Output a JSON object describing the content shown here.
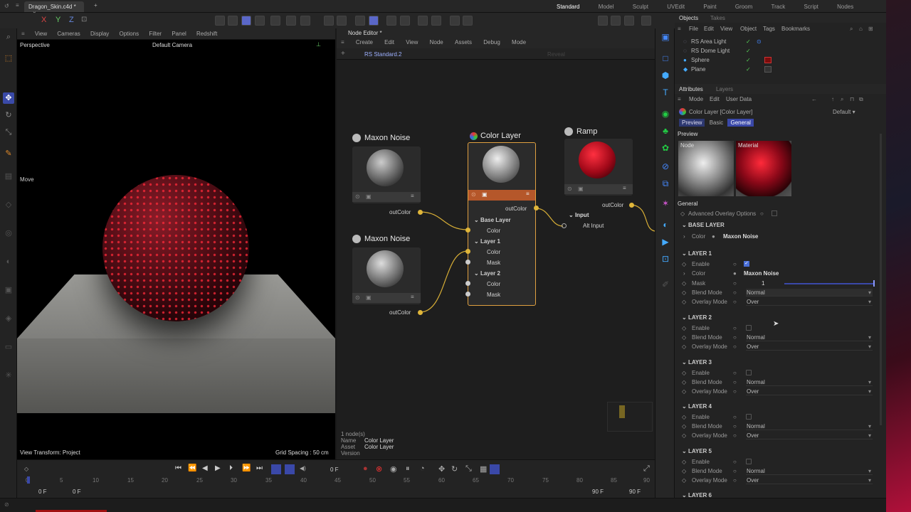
{
  "title_bar": {
    "tab_title": "Dragon_Skin.c4d *",
    "add_tab": "+"
  },
  "layouts": [
    "Standard",
    "Model",
    "Sculpt",
    "UVEdit",
    "Paint",
    "Groom",
    "Track",
    "Script",
    "Nodes"
  ],
  "active_layout": "Standard",
  "viewport": {
    "menu": [
      "View",
      "Cameras",
      "Display",
      "Options",
      "Filter",
      "Panel",
      "Redshift"
    ],
    "projection": "Perspective",
    "camera": "Default Camera",
    "tool_label": "Move",
    "view_transform": "View Transform: Project",
    "grid_spacing": "Grid Spacing : 50 cm"
  },
  "node_editor": {
    "title": "Node Editor *",
    "menu": [
      "Create",
      "Edit",
      "View",
      "Node",
      "Assets",
      "Debug",
      "Mode"
    ],
    "breadcrumb": "RS Standard.2",
    "reveal": "Reveal",
    "nodes": {
      "noise1": {
        "title": "Maxon Noise",
        "out": "outColor"
      },
      "noise2": {
        "title": "Maxon Noise",
        "out": "outColor"
      },
      "color_layer": {
        "title": "Color Layer",
        "out": "outColor",
        "base_layer": "Base Layer",
        "base_color": "Color",
        "layer1": "Layer 1",
        "layer1_color": "Color",
        "layer1_mask": "Mask",
        "layer2": "Layer 2",
        "layer2_color": "Color",
        "layer2_mask": "Mask"
      },
      "ramp": {
        "title": "Ramp",
        "out": "outColor",
        "input": "Input",
        "alt_input": "Alt Input"
      }
    },
    "info": {
      "count": "1 node(s)",
      "name_label": "Name",
      "name": "Color Layer",
      "asset_label": "Asset",
      "asset": "Color Layer",
      "version_label": "Version"
    }
  },
  "objects": {
    "tabs": [
      "Objects",
      "Takes"
    ],
    "menu": [
      "File",
      "Edit",
      "View",
      "Object",
      "Tags",
      "Bookmarks"
    ],
    "items": [
      "RS Area Light",
      "RS Dome Light",
      "Sphere",
      "Plane"
    ]
  },
  "attributes": {
    "tabs": [
      "Attributes",
      "Layers"
    ],
    "menu": [
      "Mode",
      "Edit",
      "User Data"
    ],
    "object_name": "Color Layer [Color Layer]",
    "preset": "Default",
    "subtabs": [
      "Preview",
      "Basic",
      "General"
    ],
    "preview_label": "Preview",
    "thumb_node": "Node",
    "thumb_material": "Material",
    "general_label": "General",
    "advanced_overlay": "Advanced Overlay Options",
    "base_layer": {
      "header": "BASE LAYER",
      "color_label": "Color",
      "color_value": "Maxon Noise"
    },
    "layer1": {
      "header": "LAYER 1",
      "enable": "Enable",
      "color_label": "Color",
      "color_value": "Maxon Noise",
      "mask_label": "Mask",
      "mask_value": "1",
      "blend_label": "Blend Mode",
      "blend_value": "Normal",
      "overlay_label": "Overlay Mode",
      "overlay_value": "Over"
    },
    "layer2": {
      "header": "LAYER 2",
      "enable": "Enable",
      "blend_label": "Blend Mode",
      "blend_value": "Normal",
      "overlay_label": "Overlay Mode",
      "overlay_value": "Over"
    },
    "layer3": {
      "header": "LAYER 3",
      "enable": "Enable",
      "blend_label": "Blend Mode",
      "blend_value": "Normal",
      "overlay_label": "Overlay Mode",
      "overlay_value": "Over"
    },
    "layer4": {
      "header": "LAYER 4",
      "enable": "Enable",
      "blend_label": "Blend Mode",
      "blend_value": "Normal",
      "overlay_label": "Overlay Mode",
      "overlay_value": "Over"
    },
    "layer5": {
      "header": "LAYER 5",
      "enable": "Enable",
      "blend_label": "Blend Mode",
      "blend_value": "Normal",
      "overlay_label": "Overlay Mode",
      "overlay_value": "Over"
    },
    "layer6": {
      "header": "LAYER 6"
    }
  },
  "timeline": {
    "current_frame": "0 F",
    "ticks": [
      "0",
      "5",
      "10",
      "15",
      "20",
      "25",
      "30",
      "35",
      "40",
      "45",
      "50",
      "55",
      "60",
      "65",
      "70",
      "75",
      "80",
      "85",
      "90"
    ],
    "start": "0 F",
    "start2": "0 F",
    "end": "90 F",
    "end2": "90 F"
  },
  "colors": {
    "accent": "#5a67c8",
    "wire": "#e0b63a",
    "header_orange": "#b5572a",
    "check": "#4a6fd8"
  }
}
